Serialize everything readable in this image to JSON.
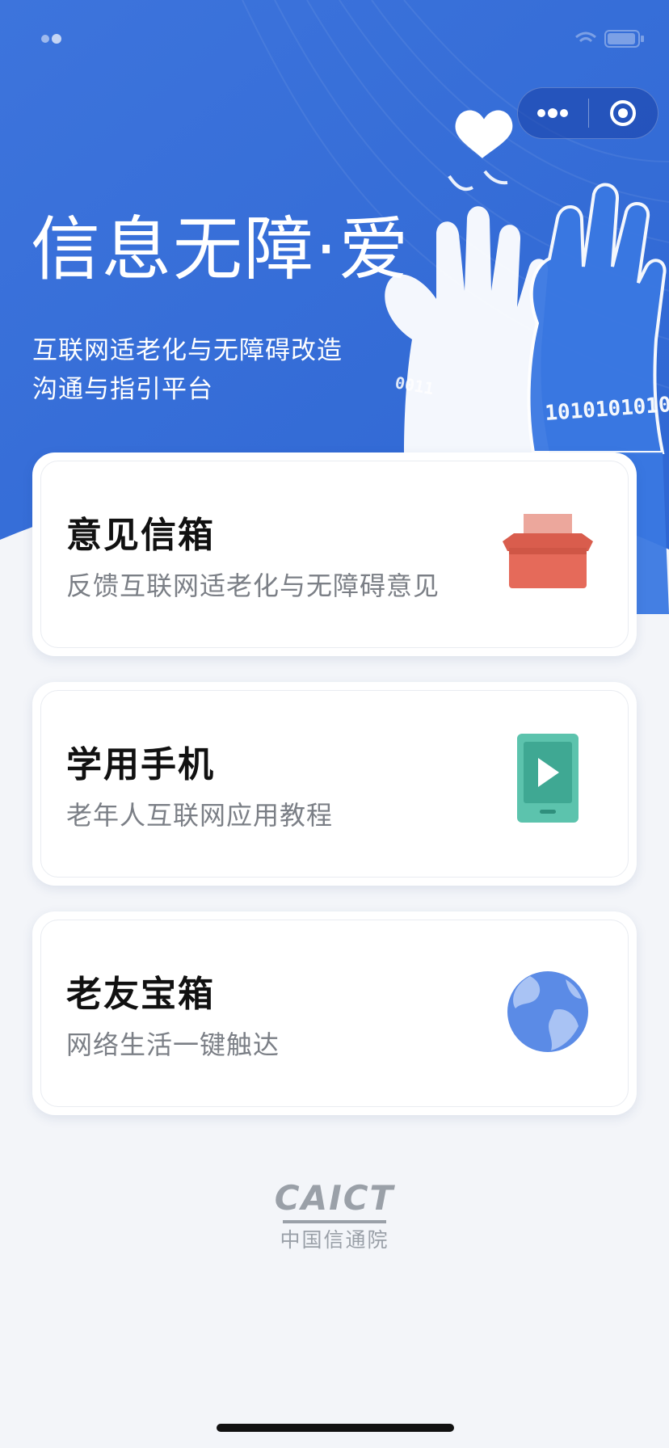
{
  "header": {
    "title_main": "信息无障",
    "title_dot": "·",
    "title_tail": "爱",
    "subtitle_line1": "互联网适老化与无障碍改造",
    "subtitle_line2": "沟通与指引平台",
    "hero_binary_1": "1010101010",
    "hero_binary_2": "0011",
    "capsule": {
      "more_icon": "more-dots-icon",
      "close_icon": "target-close-icon"
    }
  },
  "cards": [
    {
      "title": "意见信箱",
      "description": "反馈互联网适老化与无障碍意见",
      "icon": "mailbox-icon"
    },
    {
      "title": "学用手机",
      "description": "老年人互联网应用教程",
      "icon": "phone-play-icon"
    },
    {
      "title": "老友宝箱",
      "description": "网络生活一键触达",
      "icon": "globe-icon"
    }
  ],
  "footer": {
    "logo_en": "CAICT",
    "logo_cn": "中国信通院"
  },
  "colors": {
    "hero_blue": "#3f78df",
    "card_bg": "#ffffff",
    "mailbox": "#e56a5a",
    "phone": "#5cc3ad",
    "globe": "#5b8be6",
    "logo_gray": "#9aa0a8"
  }
}
